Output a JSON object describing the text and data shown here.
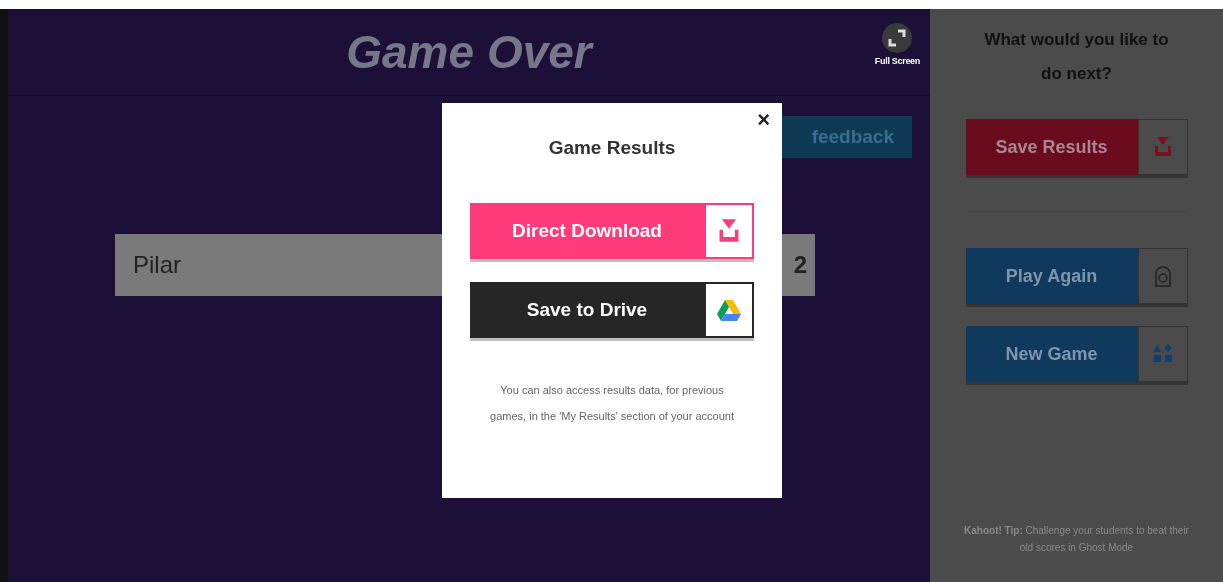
{
  "header": {
    "title": "Game Over",
    "fullscreen_button": {
      "label": "Full Screen"
    }
  },
  "feedback_button": {
    "label": "feedback"
  },
  "players": [
    {
      "name": "Pilar",
      "score": "2"
    }
  ],
  "sidebar": {
    "heading": "What would you like to do next?",
    "buttons": [
      {
        "label": "Save Results",
        "kind": "save"
      },
      {
        "label": "Play Again",
        "kind": "play"
      },
      {
        "label": "New Game",
        "kind": "new"
      }
    ],
    "tip": "**Kahoot! Tip:** Challenge your students to beat their old scores in Ghost Mode"
  },
  "modal": {
    "close": "×",
    "title": "Game Results",
    "buttons": [
      {
        "label": "Direct Download",
        "kind": "download"
      },
      {
        "label": "Save to Drive",
        "kind": "drive"
      }
    ],
    "note": "You can also access results data, for previous games, in the 'My Results' section of your account"
  }
}
